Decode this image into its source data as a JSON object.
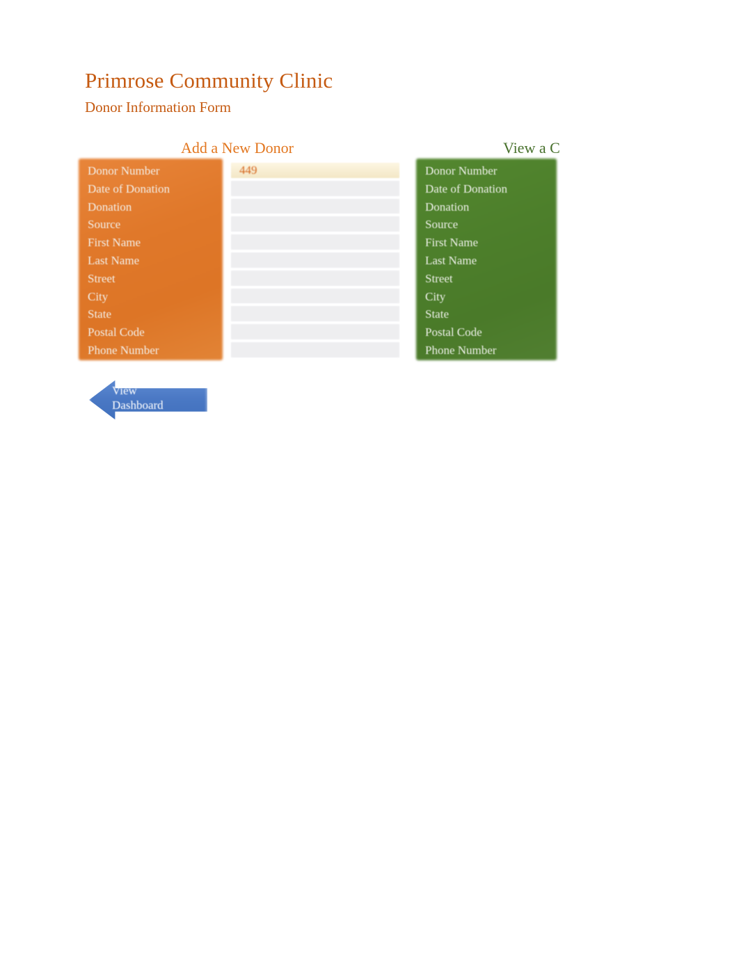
{
  "header": {
    "title": "Primrose Community Clinic",
    "subtitle": "Donor Information Form",
    "title_color": "#c55a11"
  },
  "sections": {
    "add_new_donor": {
      "heading": "Add a New Donor",
      "heading_color": "#e2761f",
      "panel_color": "#e0782a",
      "labels": [
        "Donor Number",
        "Date of Donation",
        "Donation",
        "Source",
        "First Name",
        "Last Name",
        "Street",
        "City",
        "State",
        "Postal Code",
        "Phone Number"
      ],
      "fields": [
        {
          "name": "donor-number",
          "value": "449",
          "filled": true
        },
        {
          "name": "date-of-donation",
          "value": "",
          "filled": false
        },
        {
          "name": "donation",
          "value": "",
          "filled": false
        },
        {
          "name": "source",
          "value": "",
          "filled": false
        },
        {
          "name": "first-name",
          "value": "",
          "filled": false
        },
        {
          "name": "last-name",
          "value": "",
          "filled": false
        },
        {
          "name": "street",
          "value": "",
          "filled": false
        },
        {
          "name": "city",
          "value": "",
          "filled": false
        },
        {
          "name": "state",
          "value": "",
          "filled": false
        },
        {
          "name": "postal-code",
          "value": "",
          "filled": false
        },
        {
          "name": "phone-number",
          "value": "",
          "filled": false
        }
      ]
    },
    "view_current_donor": {
      "heading": "View a C",
      "heading_color": "#47702b",
      "panel_color": "#4d7f2b",
      "labels": [
        "Donor Number",
        "Date of Donation",
        "Donation",
        "Source",
        "First Name",
        "Last Name",
        "Street",
        "City",
        "State",
        "Postal Code",
        "Phone Number"
      ]
    }
  },
  "actions": {
    "view_dashboard": {
      "label_line1": "View",
      "label_line2": "Dashboard",
      "color": "#4a78c4"
    }
  }
}
